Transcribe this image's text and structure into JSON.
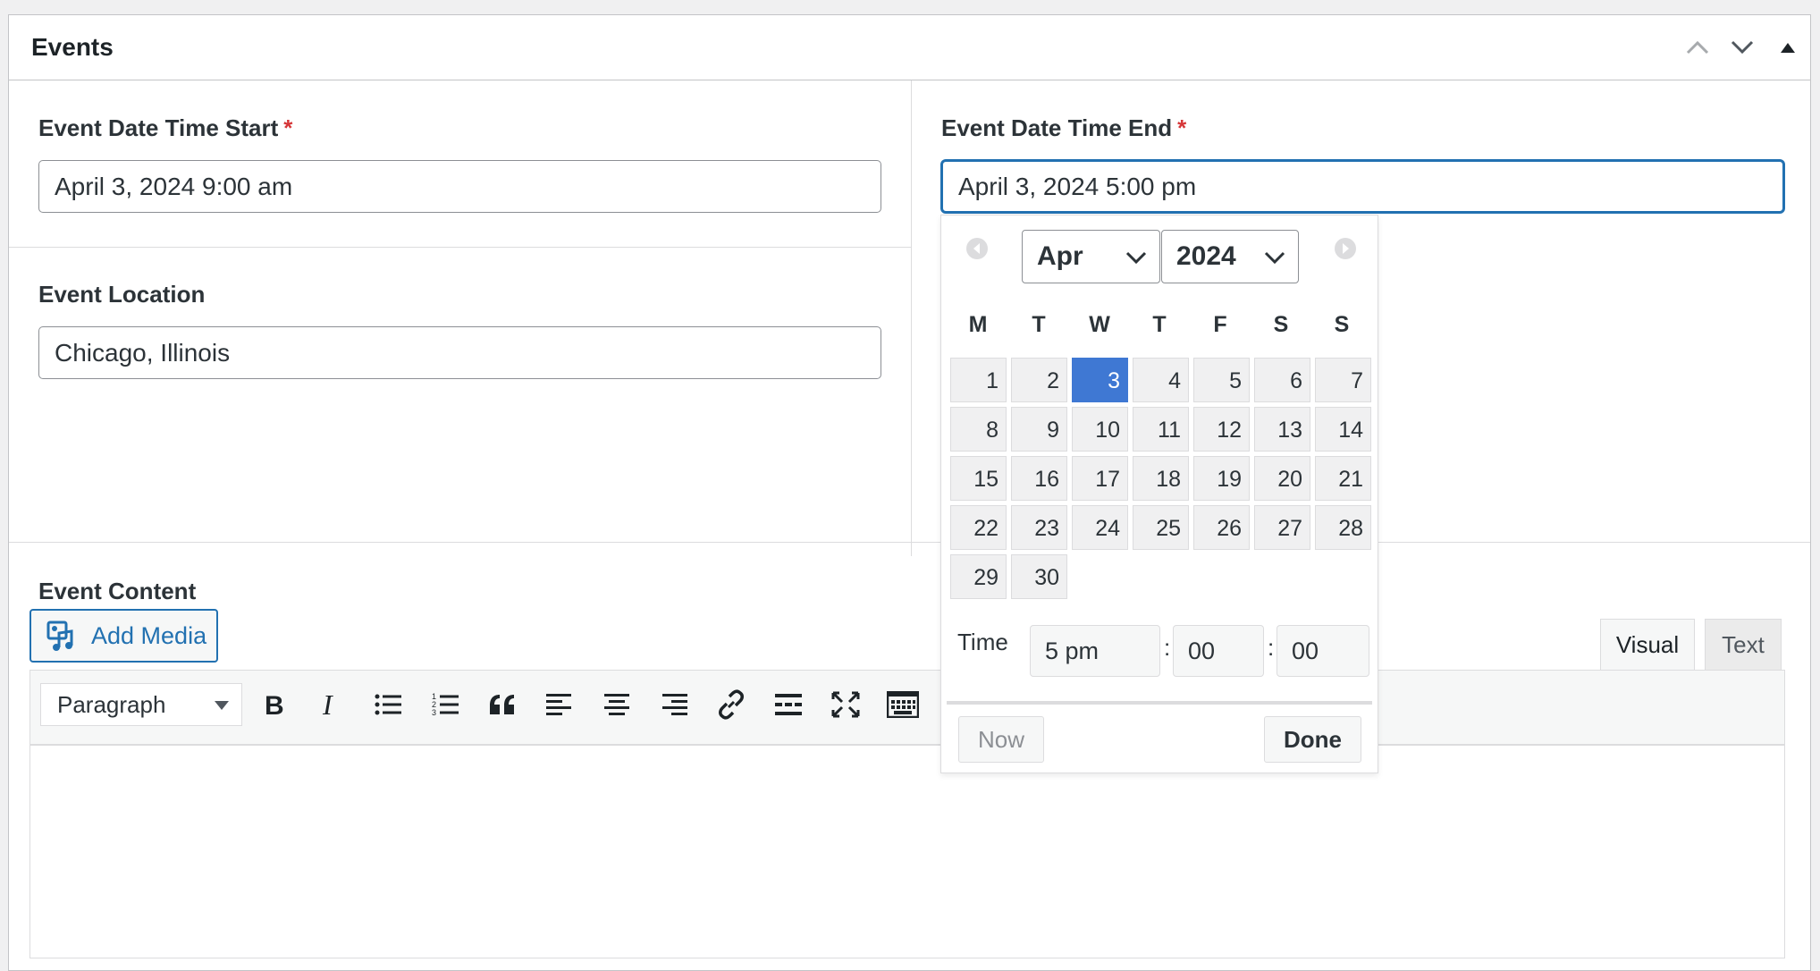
{
  "panel": {
    "title": "Events"
  },
  "fields": {
    "start": {
      "label": "Event Date Time Start",
      "required_mark": "*",
      "value": "April 3, 2024 9:00 am"
    },
    "end": {
      "label": "Event Date Time End",
      "required_mark": "*",
      "value": "April 3, 2024 5:00 pm"
    },
    "location": {
      "label": "Event Location",
      "value": "Chicago, Illinois"
    },
    "content": {
      "label": "Event Content"
    }
  },
  "editor": {
    "add_media_label": "Add Media",
    "tabs": {
      "visual": "Visual",
      "text": "Text"
    },
    "format_select": "Paragraph",
    "toolbar_icons": [
      "bold-icon",
      "italic-icon",
      "bullet-list-icon",
      "numbered-list-icon",
      "blockquote-icon",
      "align-left-icon",
      "align-center-icon",
      "align-right-icon",
      "link-icon",
      "read-more-icon",
      "fullscreen-icon",
      "keyboard-icon"
    ]
  },
  "datepicker": {
    "month": "Apr",
    "year": "2024",
    "weekdays": [
      "M",
      "T",
      "W",
      "T",
      "F",
      "S",
      "S"
    ],
    "days": [
      "1",
      "2",
      "3",
      "4",
      "5",
      "6",
      "7",
      "8",
      "9",
      "10",
      "11",
      "12",
      "13",
      "14",
      "15",
      "16",
      "17",
      "18",
      "19",
      "20",
      "21",
      "22",
      "23",
      "24",
      "25",
      "26",
      "27",
      "28",
      "29",
      "30"
    ],
    "selected_day": "3",
    "time_label": "Time",
    "hour": "5 pm",
    "colon": ":",
    "minute": "00",
    "second": "00",
    "now_label": "Now",
    "done_label": "Done",
    "colors": {
      "selected": "#3f78d3",
      "accent": "#2271b1"
    }
  }
}
